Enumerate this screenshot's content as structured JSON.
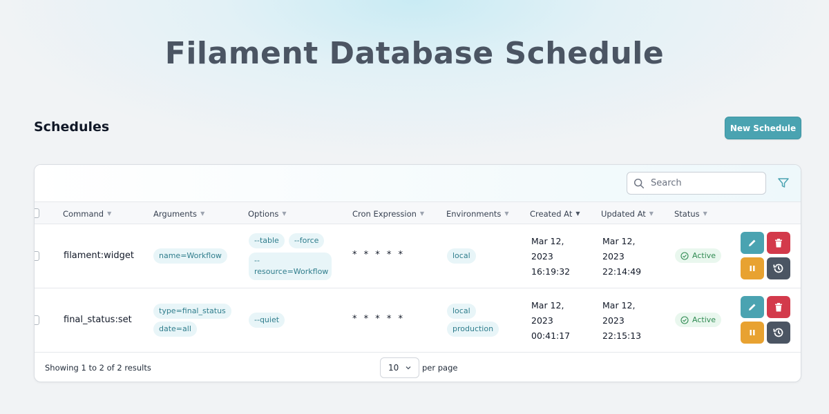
{
  "hero": {
    "title": "Filament Database Schedule"
  },
  "page": {
    "heading": "Schedules",
    "new_button": "New Schedule"
  },
  "search": {
    "placeholder": "Search"
  },
  "columns": [
    {
      "key": "command",
      "label": "Command"
    },
    {
      "key": "arguments",
      "label": "Arguments"
    },
    {
      "key": "options",
      "label": "Options"
    },
    {
      "key": "cron",
      "label": "Cron Expression"
    },
    {
      "key": "environments",
      "label": "Environments"
    },
    {
      "key": "created_at",
      "label": "Created At"
    },
    {
      "key": "updated_at",
      "label": "Updated At"
    },
    {
      "key": "status",
      "label": "Status"
    }
  ],
  "rows": [
    {
      "command": "filament:widget",
      "arguments": [
        "name=Workflow"
      ],
      "options": [
        "--table",
        "--force",
        "--resource=Workflow"
      ],
      "cron": "* * * * *",
      "environments": [
        "local"
      ],
      "created": [
        "Mar 12,",
        "2023",
        "16:19:32"
      ],
      "updated": [
        "Mar 12,",
        "2023",
        "22:14:49"
      ],
      "status": "Active"
    },
    {
      "command": "final_status:set",
      "arguments": [
        "type=final_status",
        "date=all"
      ],
      "options": [
        "--quiet"
      ],
      "cron": "* * * * *",
      "environments": [
        "local",
        "production"
      ],
      "created": [
        "Mar 12,",
        "2023",
        "00:41:17"
      ],
      "updated": [
        "Mar 12,",
        "2023",
        "22:15:13"
      ],
      "status": "Active"
    }
  ],
  "footer": {
    "summary": "Showing 1 to 2 of 2 results",
    "per_page_value": "10",
    "per_page_label": "per page"
  },
  "colors": {
    "accent": "#4aa3b1",
    "danger": "#d33a4b",
    "warning": "#e8a231",
    "secondary": "#4b5563",
    "success": "#2f8a52"
  }
}
